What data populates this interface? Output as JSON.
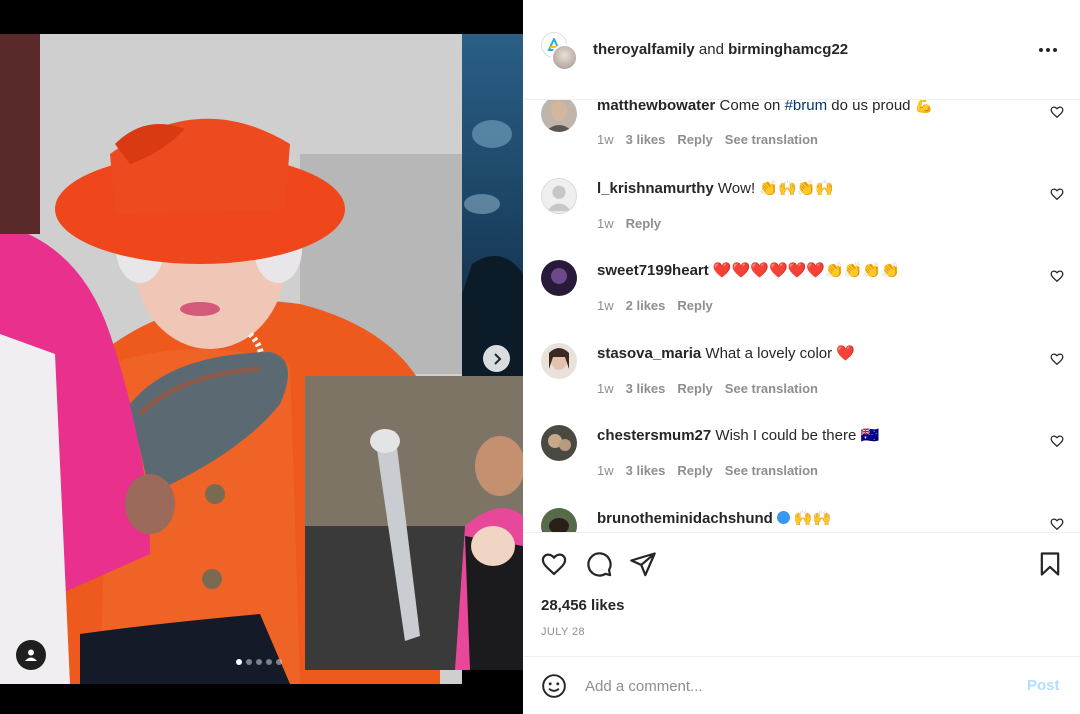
{
  "header": {
    "username_1": "theroyalfamily",
    "joiner": "and",
    "username_2": "birminghamcg22"
  },
  "comments": [
    {
      "user": "matthewbowater",
      "text_before": "Come on ",
      "hashtag": "#brum",
      "text_after": " do us proud 💪",
      "time": "1w",
      "likes": "3 likes",
      "reply": "Reply",
      "translate": "See translation"
    },
    {
      "user": "l_krishnamurthy",
      "text": "Wow! 👏🙌👏🙌",
      "time": "1w",
      "reply": "Reply"
    },
    {
      "user": "sweet7199heart",
      "text": "❤️❤️❤️❤️❤️❤️👏👏👏👏",
      "time": "1w",
      "likes": "2 likes",
      "reply": "Reply"
    },
    {
      "user": "stasova_maria",
      "text": "What a lovely color ❤️",
      "time": "1w",
      "likes": "3 likes",
      "reply": "Reply",
      "translate": "See translation"
    },
    {
      "user": "chestersmum27",
      "text": "Wish I could be there 🇦🇺",
      "time": "1w",
      "likes": "3 likes",
      "reply": "Reply",
      "translate": "See translation"
    },
    {
      "user": "brunotheminidachshund",
      "text": "🙌🙌",
      "verified": true
    }
  ],
  "post": {
    "likes": "28,456 likes",
    "date": "JULY 28"
  },
  "composer": {
    "placeholder": "Add a comment...",
    "post_label": "Post"
  },
  "carousel": {
    "dots": 5,
    "active_dot": 0
  },
  "colors": {
    "accent_link": "#00376b",
    "post_disabled": "#b2dffc",
    "meta_gray": "#8e8e8e",
    "text": "#262626"
  }
}
